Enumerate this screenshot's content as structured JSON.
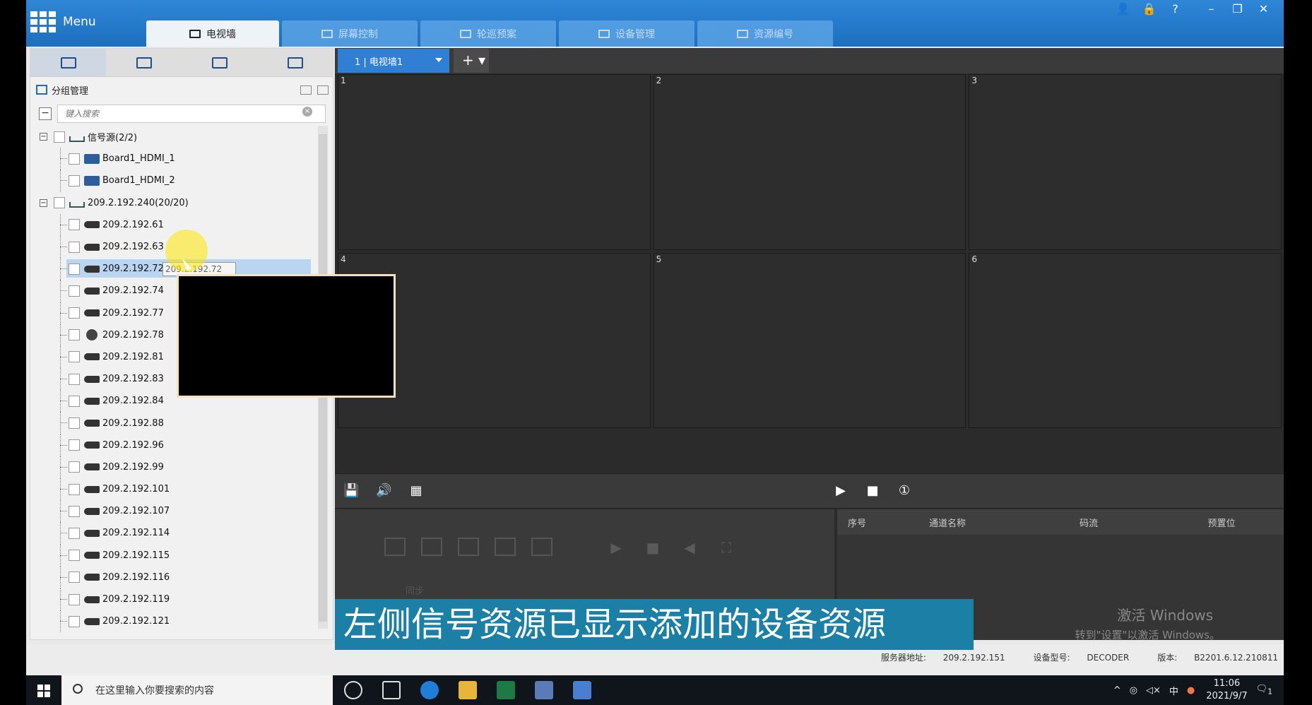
{
  "app": {
    "menu_label": "Menu",
    "tabs": [
      {
        "label": "电视墙",
        "active": true
      },
      {
        "label": "屏幕控制",
        "active": false
      },
      {
        "label": "轮巡预案",
        "active": false
      },
      {
        "label": "设备管理",
        "active": false
      },
      {
        "label": "资源编号",
        "active": false
      }
    ],
    "window_controls": [
      "user-icon",
      "lock-icon",
      "help-icon",
      "minimize-icon",
      "restore-icon",
      "close-icon"
    ]
  },
  "left_panel": {
    "group_title": "分组管理",
    "search_placeholder": "键入搜索",
    "tree": [
      {
        "label": "信号源(2/2)",
        "level": 0,
        "icon": "group-icon",
        "expander": "⊟"
      },
      {
        "label": "Board1_HDMI_1",
        "level": 1,
        "icon": "hdmi-icon"
      },
      {
        "label": "Board1_HDMI_2",
        "level": 1,
        "icon": "hdmi-icon"
      },
      {
        "label": "209.2.192.240(20/20)",
        "level": 0,
        "icon": "group-icon",
        "expander": "⊟"
      },
      {
        "label": "209.2.192.61",
        "level": 1,
        "icon": "camera-icon"
      },
      {
        "label": "209.2.192.63",
        "level": 1,
        "icon": "camera-icon"
      },
      {
        "label": "209.2.192.72",
        "level": 1,
        "icon": "camera-icon",
        "selected": true
      },
      {
        "label": "209.2.192.74",
        "level": 1,
        "icon": "camera-icon"
      },
      {
        "label": "209.2.192.77",
        "level": 1,
        "icon": "camera-icon"
      },
      {
        "label": "209.2.192.78",
        "level": 1,
        "icon": "dome-camera-icon"
      },
      {
        "label": "209.2.192.81",
        "level": 1,
        "icon": "camera-icon"
      },
      {
        "label": "209.2.192.83",
        "level": 1,
        "icon": "camera-icon"
      },
      {
        "label": "209.2.192.84",
        "level": 1,
        "icon": "camera-icon"
      },
      {
        "label": "209.2.192.88",
        "level": 1,
        "icon": "camera-icon"
      },
      {
        "label": "209.2.192.96",
        "level": 1,
        "icon": "camera-icon"
      },
      {
        "label": "209.2.192.99",
        "level": 1,
        "icon": "camera-icon"
      },
      {
        "label": "209.2.192.101",
        "level": 1,
        "icon": "camera-icon"
      },
      {
        "label": "209.2.192.107",
        "level": 1,
        "icon": "camera-icon"
      },
      {
        "label": "209.2.192.114",
        "level": 1,
        "icon": "camera-icon"
      },
      {
        "label": "209.2.192.115",
        "level": 1,
        "icon": "camera-icon"
      },
      {
        "label": "209.2.192.116",
        "level": 1,
        "icon": "camera-icon"
      },
      {
        "label": "209.2.192.119",
        "level": 1,
        "icon": "camera-icon"
      },
      {
        "label": "209.2.192.121",
        "level": 1,
        "icon": "camera-icon"
      }
    ],
    "hover_tooltip": "209.2.192.72"
  },
  "right_panel": {
    "wall_select": "1 | 电视墙1",
    "screens": [
      "1",
      "2",
      "3",
      "4",
      "5",
      "6"
    ],
    "table_headers": [
      "序号",
      "通道名称",
      "码流",
      "预置位"
    ],
    "lower_button": "同步"
  },
  "status": {
    "server_label": "服务器地址:",
    "server_value": "209.2.192.151",
    "model_label": "设备型号:",
    "model_value": "DECODER",
    "version_label": "版本:",
    "version_value": "B2201.6.12.210811"
  },
  "watermark": {
    "line1": "激活 Windows",
    "line2": "转到\"设置\"以激活 Windows。"
  },
  "subtitle": "左侧信号资源已显示添加的设备资源",
  "taskbar": {
    "search_placeholder": "在这里输入你要搜索的内容",
    "ime": "中",
    "time": "11:06",
    "date": "2021/9/7",
    "notif_count": "1"
  },
  "colors": {
    "accent": "#2f86d6",
    "subtitle_bg": "#1c7fa6",
    "selection": "#b9d5f2"
  }
}
